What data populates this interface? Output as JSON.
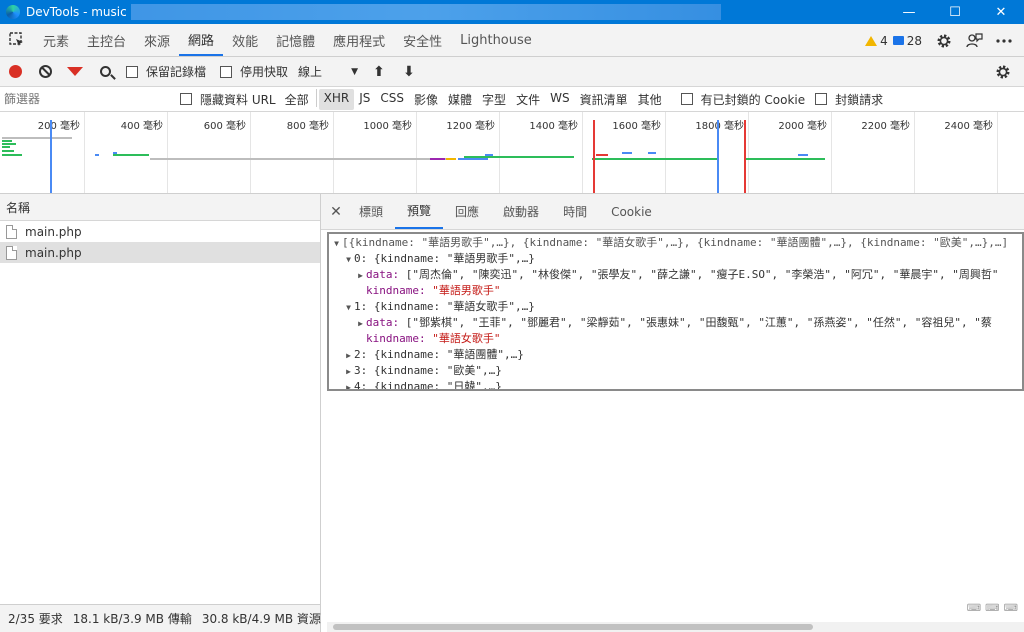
{
  "window": {
    "title": "DevTools - music",
    "minimize_glyph": "—",
    "maximize_glyph": "☐",
    "close_glyph": "✕"
  },
  "main_tabs": [
    {
      "label": "元素"
    },
    {
      "label": "主控台"
    },
    {
      "label": "來源"
    },
    {
      "label": "網路",
      "active": true
    },
    {
      "label": "效能"
    },
    {
      "label": "記憶體"
    },
    {
      "label": "應用程式"
    },
    {
      "label": "安全性"
    },
    {
      "label": "Lighthouse"
    }
  ],
  "badges": {
    "warnings": "4",
    "messages": "28"
  },
  "icons": {
    "inspect": "inspect-element-icon",
    "settings": "gear-icon",
    "feedback": "feedback-icon",
    "more": "more-icon"
  },
  "toolbar": {
    "preserve_log": "保留記錄檔",
    "disable_cache": "停用快取",
    "throttle": "線上",
    "throttle_glyph": "▼",
    "upload_glyph": "⬆",
    "download_glyph": "⬇"
  },
  "filter": {
    "placeholder": "篩選器",
    "hide_data_urls": "隱藏資料 URL",
    "types": [
      "全部",
      "XHR",
      "JS",
      "CSS",
      "影像",
      "媒體",
      "字型",
      "文件",
      "WS",
      "資訊清單",
      "其他"
    ],
    "active_type": "XHR",
    "blocked_cookies": "有已封鎖的 Cookie",
    "blocked_requests": "封鎖請求"
  },
  "overview": {
    "ticks": [
      "200 毫秒",
      "400 毫秒",
      "600 毫秒",
      "800 毫秒",
      "1000 毫秒",
      "1200 毫秒",
      "1400 毫秒",
      "1600 毫秒",
      "1800 毫秒",
      "2000 毫秒",
      "2200 毫秒",
      "2400 毫秒"
    ],
    "colors": {
      "green": "#2dbd5a",
      "gray": "#bdbdbd",
      "blue": "#4a8af4",
      "red": "#e53935",
      "purple": "#9c27b0",
      "yellow": "#f2b600"
    }
  },
  "requests": {
    "column_name": "名稱",
    "items": [
      {
        "name": "main.php",
        "selected": false
      },
      {
        "name": "main.php",
        "selected": true
      }
    ]
  },
  "status": {
    "requests": "2/35 要求",
    "transferred": "18.1 kB/3.9 MB 傳輸",
    "resources": "30.8 kB/4.9 MB 資源"
  },
  "detail_tabs": [
    {
      "label": "標頭"
    },
    {
      "label": "預覽",
      "active": true
    },
    {
      "label": "回應"
    },
    {
      "label": "啟動器"
    },
    {
      "label": "時間"
    },
    {
      "label": "Cookie"
    }
  ],
  "preview": {
    "root": "[{kindname: \"華語男歌手\",…}, {kindname: \"華語女歌手\",…}, {kindname: \"華語團體\",…}, {kindname: \"歐美\",…},…]",
    "item0": "0: {kindname: \"華語男歌手\",…}",
    "item0_data_key": "data:",
    "item0_data": "[\"周杰倫\", \"陳奕迅\", \"林俊傑\", \"張學友\", \"薛之謙\", \"瘦子E.SO\", \"李榮浩\", \"阿冗\", \"華晨宇\", \"周興哲\"",
    "item0_kind_key": "kindname:",
    "item0_kind": "\"華語男歌手\"",
    "item1": "1: {kindname: \"華語女歌手\",…}",
    "item1_data_key": "data:",
    "item1_data": "[\"鄧紫棋\", \"王菲\", \"鄧麗君\", \"梁靜茹\", \"張惠妹\", \"田馥甄\", \"江蕙\", \"孫燕姿\", \"任然\", \"容祖兒\", \"蔡",
    "item1_kind_key": "kindname:",
    "item1_kind": "\"華語女歌手\"",
    "item2": "2: {kindname: \"華語團體\",…}",
    "item3": "3: {kindname: \"歐美\",…}",
    "item4": "4: {kindname: \"日韓\",…}"
  }
}
